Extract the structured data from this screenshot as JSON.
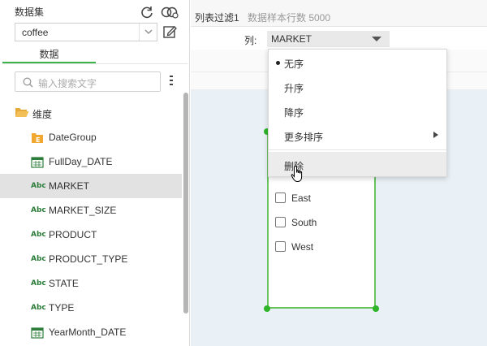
{
  "left_panel": {
    "dataset_label": "数据集",
    "dataset_value": "coffee",
    "tab_data": "数据",
    "search_placeholder": "输入搜索文字",
    "tree_root": "维度",
    "fields": [
      {
        "label": "DateGroup",
        "icon": "date-group-icon"
      },
      {
        "label": "FullDay_DATE",
        "icon": "calendar-icon"
      },
      {
        "label": "MARKET",
        "icon": "abc-icon",
        "selected": true
      },
      {
        "label": "MARKET_SIZE",
        "icon": "abc-icon"
      },
      {
        "label": "PRODUCT",
        "icon": "abc-icon"
      },
      {
        "label": "PRODUCT_TYPE",
        "icon": "abc-icon"
      },
      {
        "label": "STATE",
        "icon": "abc-icon"
      },
      {
        "label": "TYPE",
        "icon": "abc-icon"
      },
      {
        "label": "YearMonth_DATE",
        "icon": "calendar-icon"
      }
    ],
    "abc_text": "Abc"
  },
  "right_panel": {
    "filter_name": "列表过滤1",
    "sample_count": "数据样本行数 5000",
    "column_label": "列:",
    "column_value": "MARKET",
    "options": [
      "East",
      "South",
      "West"
    ]
  },
  "menu": {
    "items": [
      {
        "label": "无序",
        "checked": true
      },
      {
        "label": "升序"
      },
      {
        "label": "降序"
      },
      {
        "label": "更多排序",
        "submenu": true
      },
      {
        "label": "删除",
        "hover": true
      }
    ]
  },
  "colors": {
    "accent_green": "#3cb44b",
    "selection_border": "#69c45d",
    "canvas_bg": "#e9f1f7"
  }
}
